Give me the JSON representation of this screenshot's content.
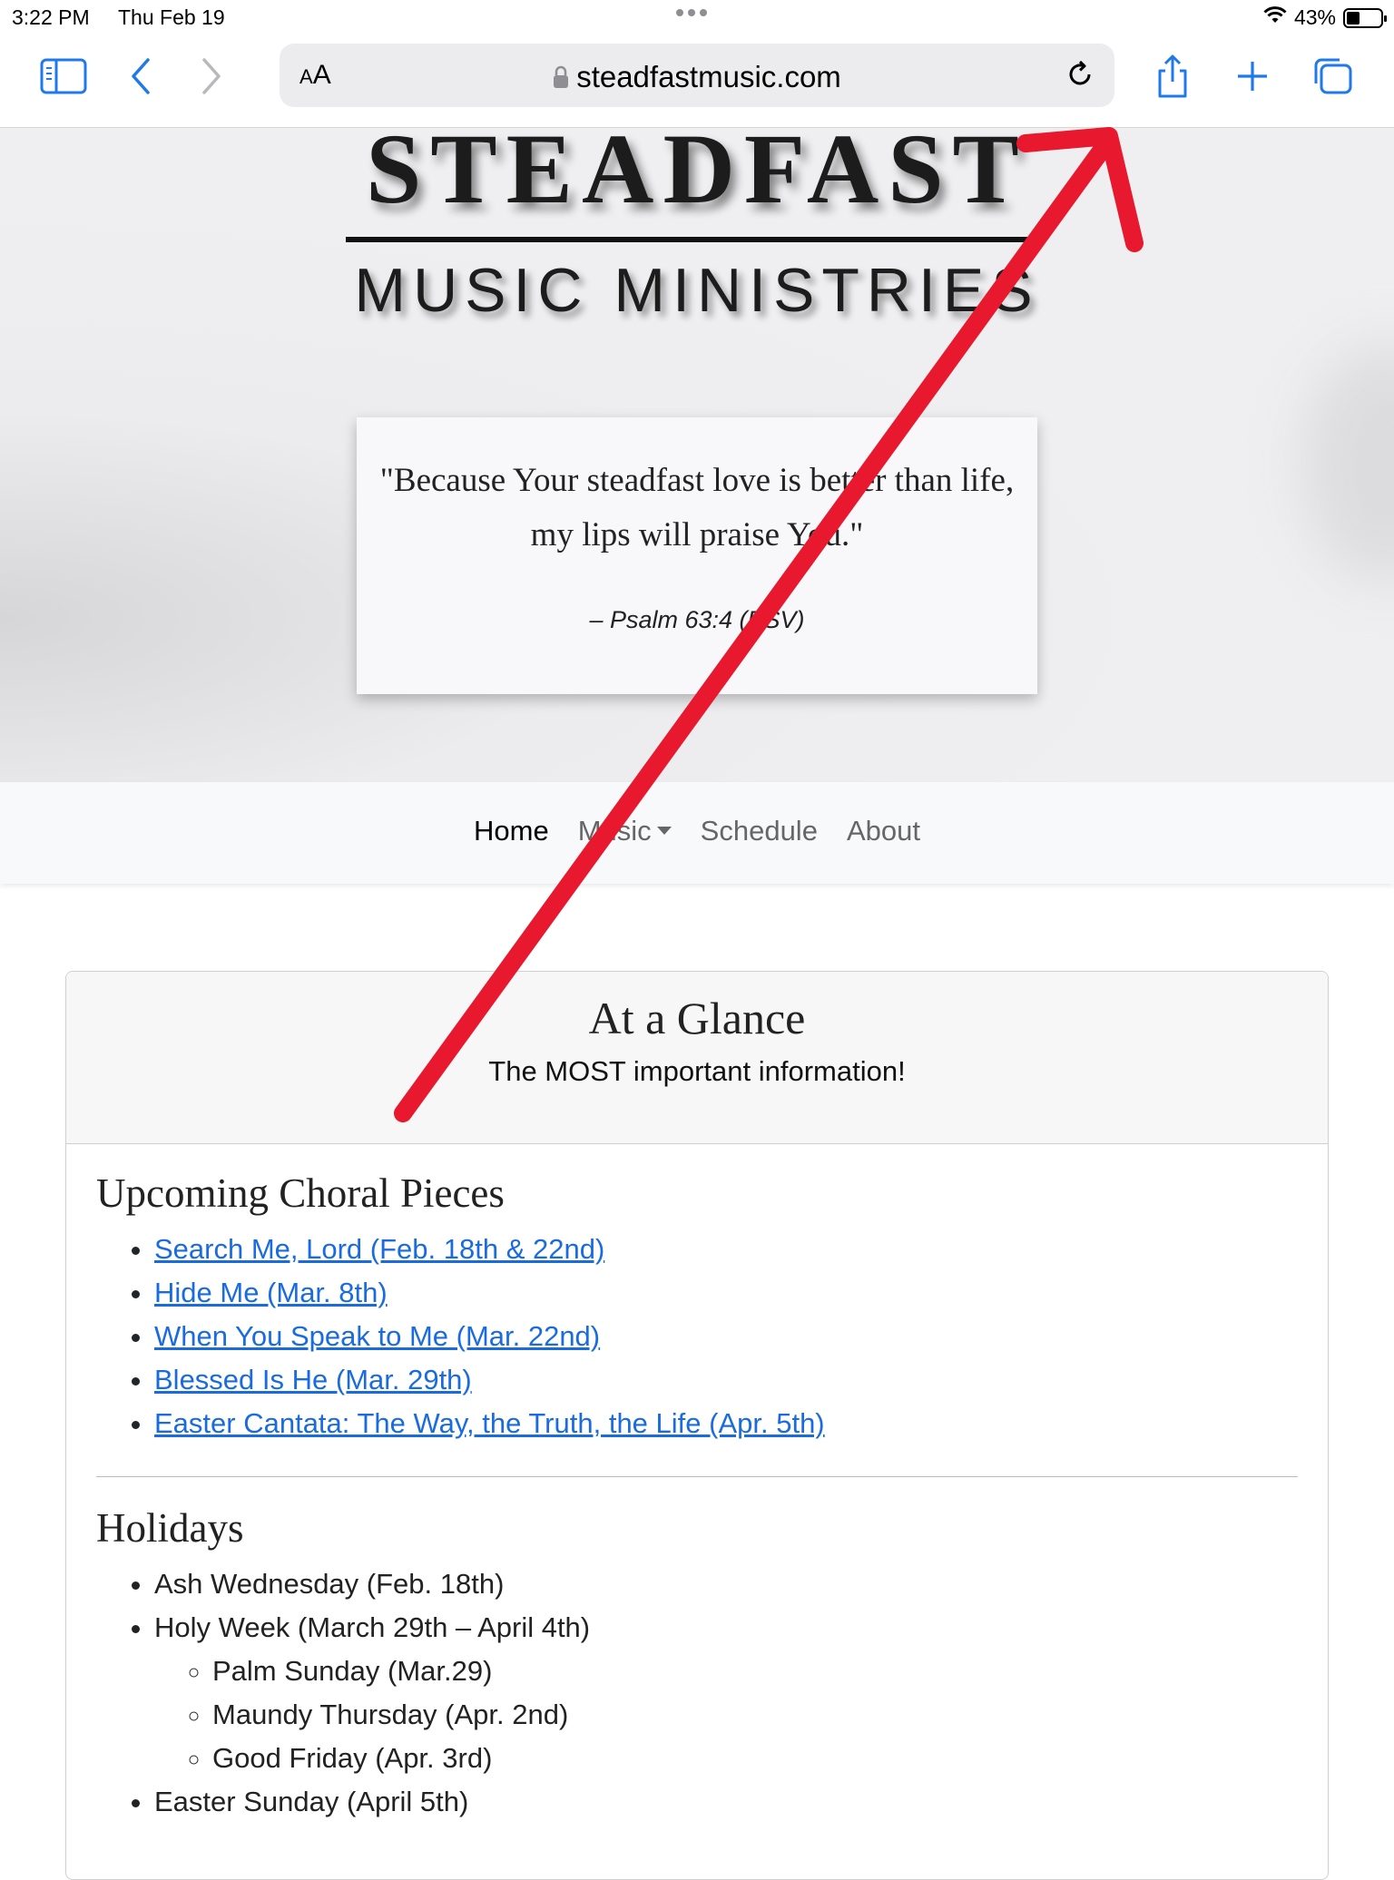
{
  "status": {
    "time": "3:22 PM",
    "date": "Thu Feb 19",
    "battery": "43%"
  },
  "browser": {
    "aa_label_small": "A",
    "aa_label_big": "A",
    "url": "steadfastmusic.com"
  },
  "hero": {
    "title": "STEADFAST",
    "subtitle": "MUSIC MINISTRIES",
    "quote": "\"Because Your steadfast love is better than life, my lips will praise You.\"",
    "citation": "– Psalm 63:4 (ESV)"
  },
  "nav": {
    "home": "Home",
    "music": "Music",
    "schedule": "Schedule",
    "about": "About"
  },
  "glance": {
    "title": "At a Glance",
    "subtitle": "The MOST important information!",
    "choral_heading": "Upcoming Choral Pieces",
    "choral_pieces": [
      "Search Me, Lord (Feb. 18th & 22nd)",
      "Hide Me (Mar. 8th)",
      "When You Speak to Me (Mar. 22nd)",
      "Blessed Is He (Mar. 29th)",
      "Easter Cantata: The Way, the Truth, the Life (Apr. 5th)"
    ],
    "holidays_heading": "Holidays",
    "holidays": [
      "Ash Wednesday (Feb. 18th)",
      "Holy Week (March 29th – April 4th)",
      "Easter Sunday (April 5th)"
    ],
    "holy_week_days": [
      "Palm Sunday (Mar.29)",
      "Maundy Thursday (Apr. 2nd)",
      "Good Friday (Apr. 3rd)"
    ]
  },
  "colors": {
    "link": "#1a6be0",
    "ios_blue": "#1f7ae8",
    "annotation_arrow": "#e8192e"
  }
}
